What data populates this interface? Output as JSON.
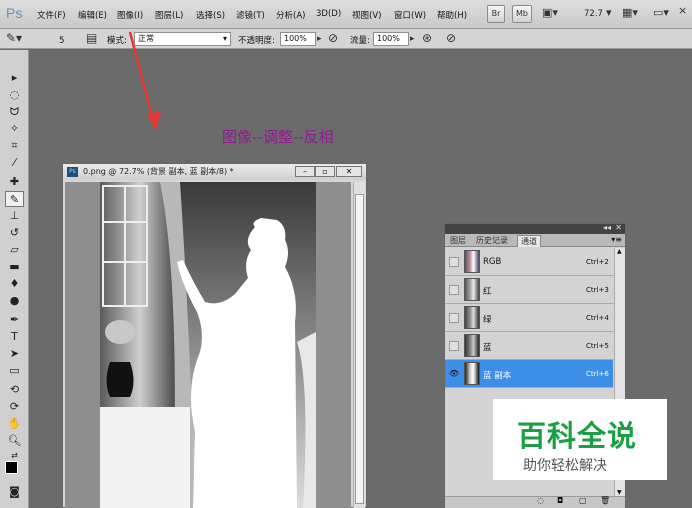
{
  "app": {
    "logo": "Ps"
  },
  "menu": [
    "文件(F)",
    "编辑(E)",
    "图像(I)",
    "图层(L)",
    "选择(S)",
    "滤镜(T)",
    "分析(A)",
    "3D(D)",
    "视图(V)",
    "窗口(W)",
    "帮助(H)"
  ],
  "menubar_buttons": {
    "br": "Br",
    "mb": "Mb",
    "zoom": "72.7"
  },
  "options": {
    "brush_size": "5",
    "mode_label": "模式:",
    "mode_value": "正常",
    "opacity_label": "不透明度:",
    "opacity_value": "100%",
    "flow_label": "流量:",
    "flow_value": "100%"
  },
  "annotation": "图像--调整--反相",
  "document": {
    "title": "0.png @ 72.7% (背景 副本, 蓝 副本/8) *"
  },
  "panel": {
    "tabs": [
      "图层",
      "历史记录",
      "通道"
    ],
    "selected_tab": 2,
    "channels": [
      {
        "name": "RGB",
        "shortcut": "Ctrl+2",
        "selected": false
      },
      {
        "name": "红",
        "shortcut": "Ctrl+3",
        "selected": false
      },
      {
        "name": "绿",
        "shortcut": "Ctrl+4",
        "selected": false
      },
      {
        "name": "蓝",
        "shortcut": "Ctrl+5",
        "selected": false
      },
      {
        "name": "蓝 副本",
        "shortcut": "Ctrl+6",
        "selected": true
      }
    ]
  },
  "watermark": {
    "title": "百科全说",
    "subtitle": "助你轻松解决"
  },
  "colors": {
    "accent": "#3d8ee6",
    "annotation": "#8b1e8b",
    "arrow": "#e53935",
    "watermark": "#1aa043"
  }
}
